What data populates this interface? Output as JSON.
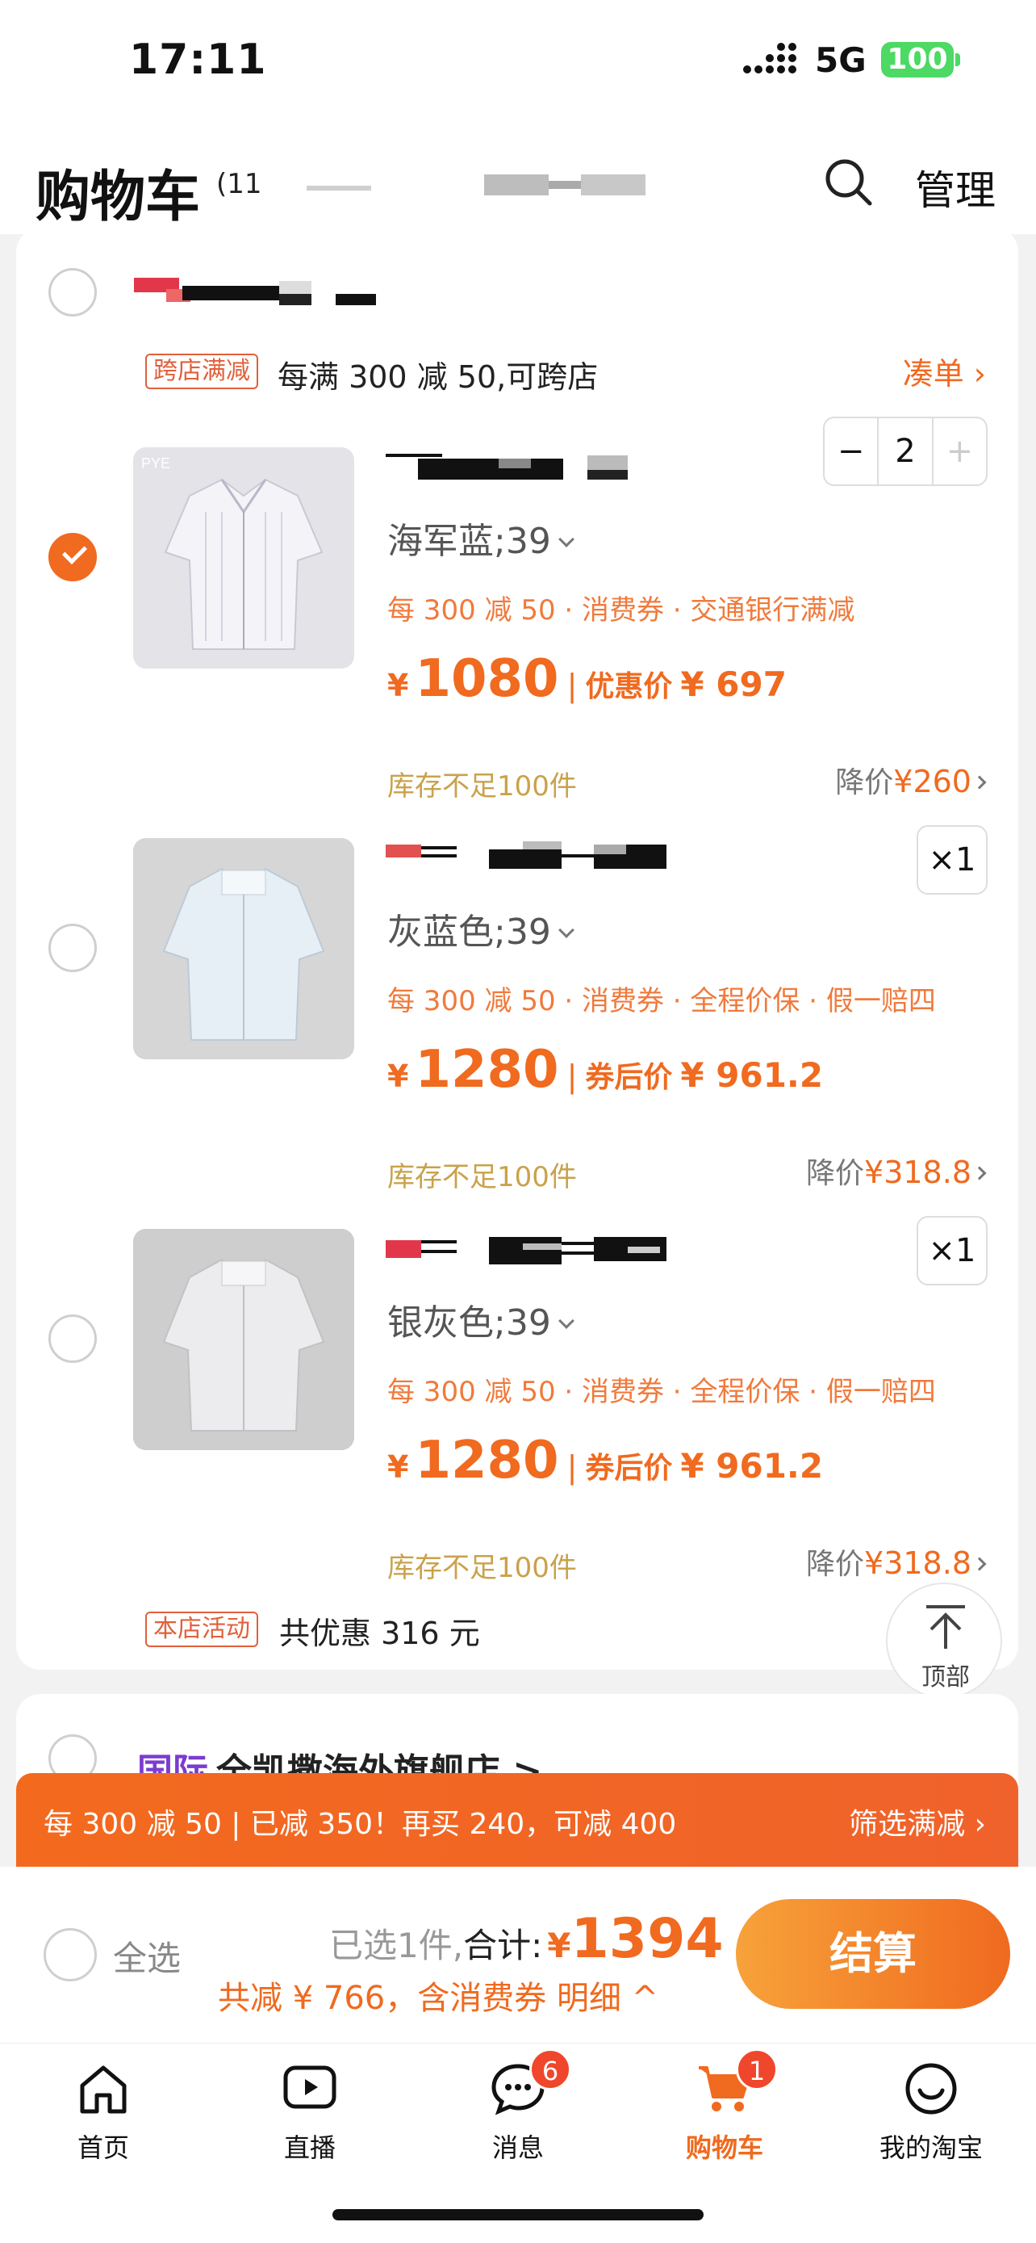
{
  "status_bar": {
    "time": "17:11",
    "network": "5G",
    "battery": "100"
  },
  "header": {
    "title": "购物车",
    "count": "(11",
    "manage": "管理"
  },
  "store": {
    "promo_tag": "跨店满减",
    "promo_text": "每满 300 减 50,可跨店",
    "coudan": "凑单"
  },
  "items": [
    {
      "checked": true,
      "variant": "海军蓝;39",
      "promos": "每 300 减 50 · 消费券 · 交通银行满减",
      "price_symbol": "¥",
      "price": "1080",
      "discount_label": "优惠价",
      "discount_price": "¥ 697",
      "stock": "库存不足100件",
      "drop_label": "降价",
      "drop_value": "¥260",
      "qty": "2",
      "qty_minus": "−",
      "qty_plus": "+",
      "img_logo": "PYE"
    },
    {
      "checked": false,
      "variant": "灰蓝色;39",
      "promos": "每 300 减 50 · 消费券 · 全程价保 · 假一赔四",
      "price_symbol": "¥",
      "price": "1280",
      "discount_label": "券后价",
      "discount_price": "¥ 961.2",
      "stock": "库存不足100件",
      "drop_label": "降价",
      "drop_value": "¥318.8",
      "qty": "×1"
    },
    {
      "checked": false,
      "variant": "银灰色;39",
      "promos": "每 300 减 50 · 消费券 · 全程价保 · 假一赔四",
      "price_symbol": "¥",
      "price": "1280",
      "discount_label": "券后价",
      "discount_price": "¥ 961.2",
      "stock": "库存不足100件",
      "drop_label": "降价",
      "drop_value": "¥318.8",
      "qty": "×1"
    }
  ],
  "shop_activity": {
    "tag": "本店活动",
    "text": "共优惠 316 元"
  },
  "to_top": {
    "label": "顶部"
  },
  "next_store": {
    "intl": "国际",
    "name": "全凯撒海外旗舰店 >"
  },
  "banner": {
    "text": "每 300 减 50 | 已减 350！再买 240，可减 400",
    "filter": "筛选满减"
  },
  "checkout": {
    "select_all": "全选",
    "selected_count": "已选1件,",
    "sum_label": "合计:",
    "currency": "¥",
    "total": "1394",
    "saved": "共减 ¥ 766，含消费券 明细",
    "pay": "结算"
  },
  "tabs": [
    {
      "label": "首页",
      "icon": "home-icon"
    },
    {
      "label": "直播",
      "icon": "live-icon"
    },
    {
      "label": "消息",
      "icon": "message-icon",
      "badge": "6"
    },
    {
      "label": "购物车",
      "icon": "cart-icon",
      "badge": "1",
      "active": true
    },
    {
      "label": "我的淘宝",
      "icon": "profile-icon"
    }
  ],
  "colors": {
    "accent": "#f06a1f",
    "stock": "#c9a24a",
    "check": "#f06a1f"
  }
}
